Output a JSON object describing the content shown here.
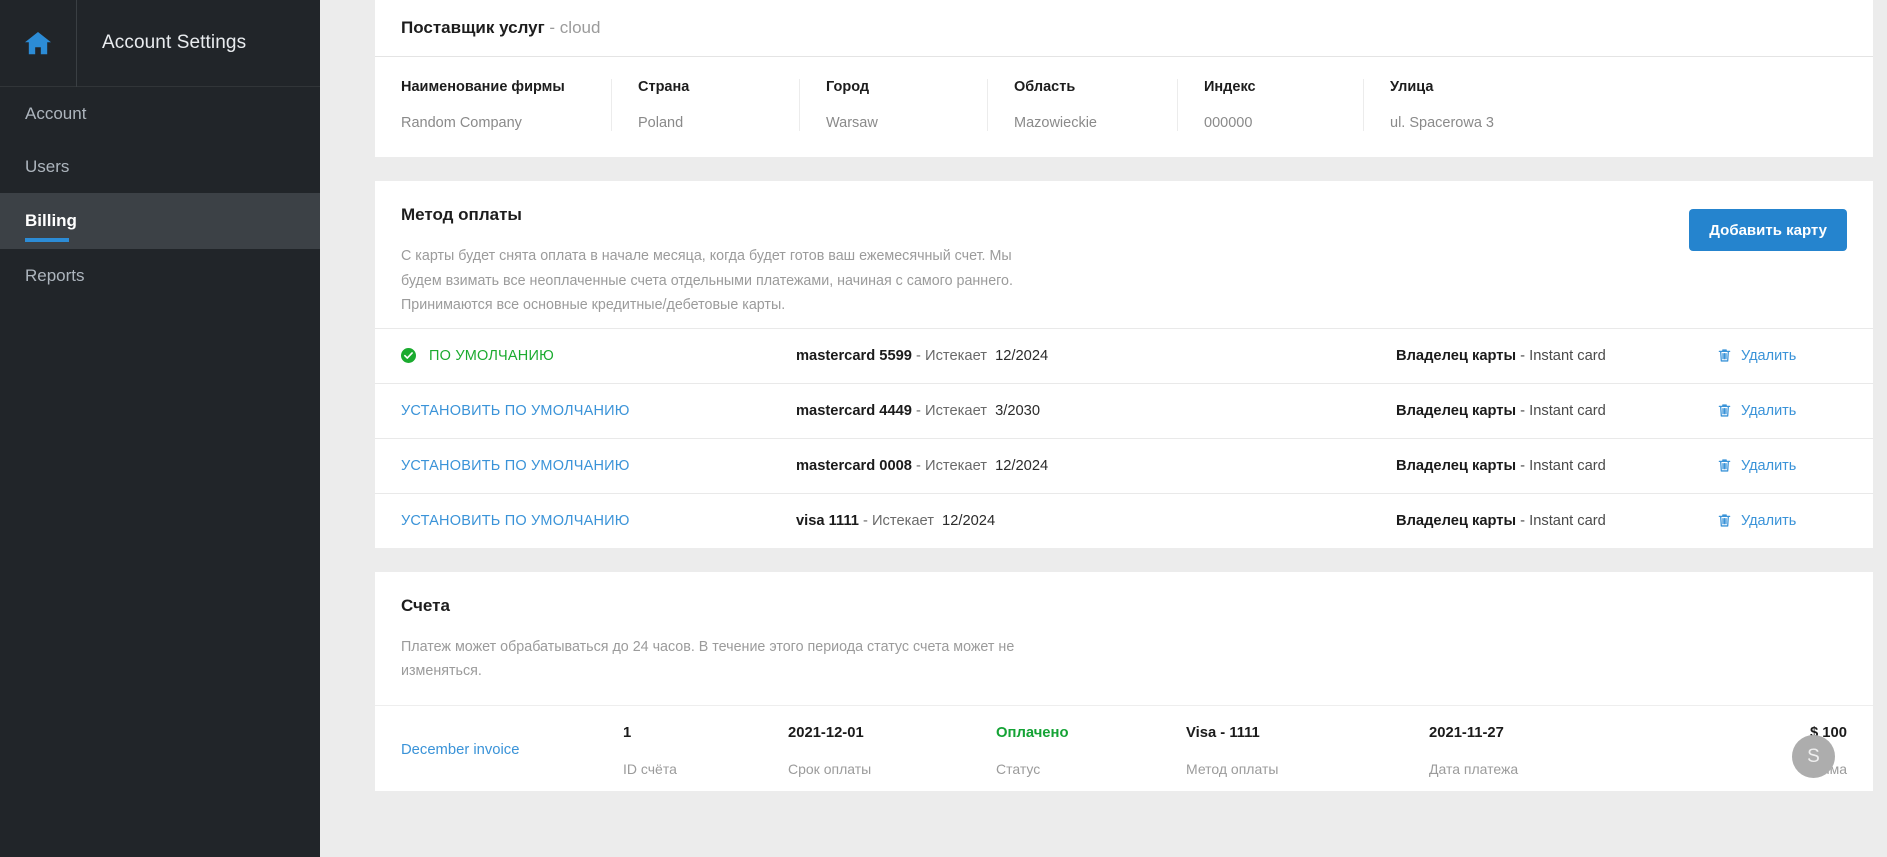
{
  "sidebar": {
    "home_icon": "home-icon",
    "title": "Account Settings",
    "items": [
      {
        "label": "Account",
        "active": false
      },
      {
        "label": "Users",
        "active": false
      },
      {
        "label": "Billing",
        "active": true
      },
      {
        "label": "Reports",
        "active": false
      }
    ]
  },
  "provider": {
    "heading": "Поставщик услуг",
    "heading_sub": "- cloud",
    "columns": [
      {
        "label": "Наименование фирмы",
        "value": "Random Company"
      },
      {
        "label": "Страна",
        "value": "Poland"
      },
      {
        "label": "Город",
        "value": "Warsaw"
      },
      {
        "label": "Область",
        "value": "Mazowieckie"
      },
      {
        "label": "Индекс",
        "value": "000000"
      },
      {
        "label": "Улица",
        "value": "ul. Spacerowa 3"
      }
    ]
  },
  "payment": {
    "title": "Метод оплаты",
    "description": "С карты будет снята оплата в начале месяца, когда будет готов ваш ежемесячный счет. Мы будем взимать все неоплаченные счета отдельными платежами, начиная с самого раннего. Принимаются все основные кредитные/дебетовые карты.",
    "add_card_label": "Добавить карту",
    "default_label": "ПО УМОЛЧАНИЮ",
    "set_default_label": "УСТАНОВИТЬ ПО УМОЛЧАНИЮ",
    "expires_label": "- Истекает",
    "owner_label": "Владелец карты",
    "delete_label": "Удалить",
    "cards": [
      {
        "is_default": true,
        "brand_number": "mastercard 5599",
        "expires": "12/2024",
        "owner": "- Instant card"
      },
      {
        "is_default": false,
        "brand_number": "mastercard 4449",
        "expires": "3/2030",
        "owner": "- Instant card"
      },
      {
        "is_default": false,
        "brand_number": "mastercard 0008",
        "expires": "12/2024",
        "owner": "- Instant card"
      },
      {
        "is_default": false,
        "brand_number": "visa 1111",
        "expires": "12/2024",
        "owner": "- Instant card"
      }
    ]
  },
  "invoices": {
    "title": "Счета",
    "description": "Платеж может обрабатываться до 24 часов. В течение этого периода статус счета может не изменяться.",
    "labels": {
      "id": "ID счёта",
      "due": "Срок оплаты",
      "status": "Статус",
      "method": "Метод оплаты",
      "date": "Дата платежа",
      "amount": "Сумма"
    },
    "rows": [
      {
        "name": "December invoice",
        "id": "1",
        "due": "2021-12-01",
        "status": "Оплачено",
        "method": "Visa - 1111",
        "date": "2021-11-27",
        "amount": "$ 100"
      }
    ]
  },
  "avatar": {
    "initial": "S"
  },
  "colors": {
    "accent": "#2584ce",
    "sidebar_bg": "#212529",
    "success": "#1bab2f",
    "link": "#3a93d8"
  }
}
